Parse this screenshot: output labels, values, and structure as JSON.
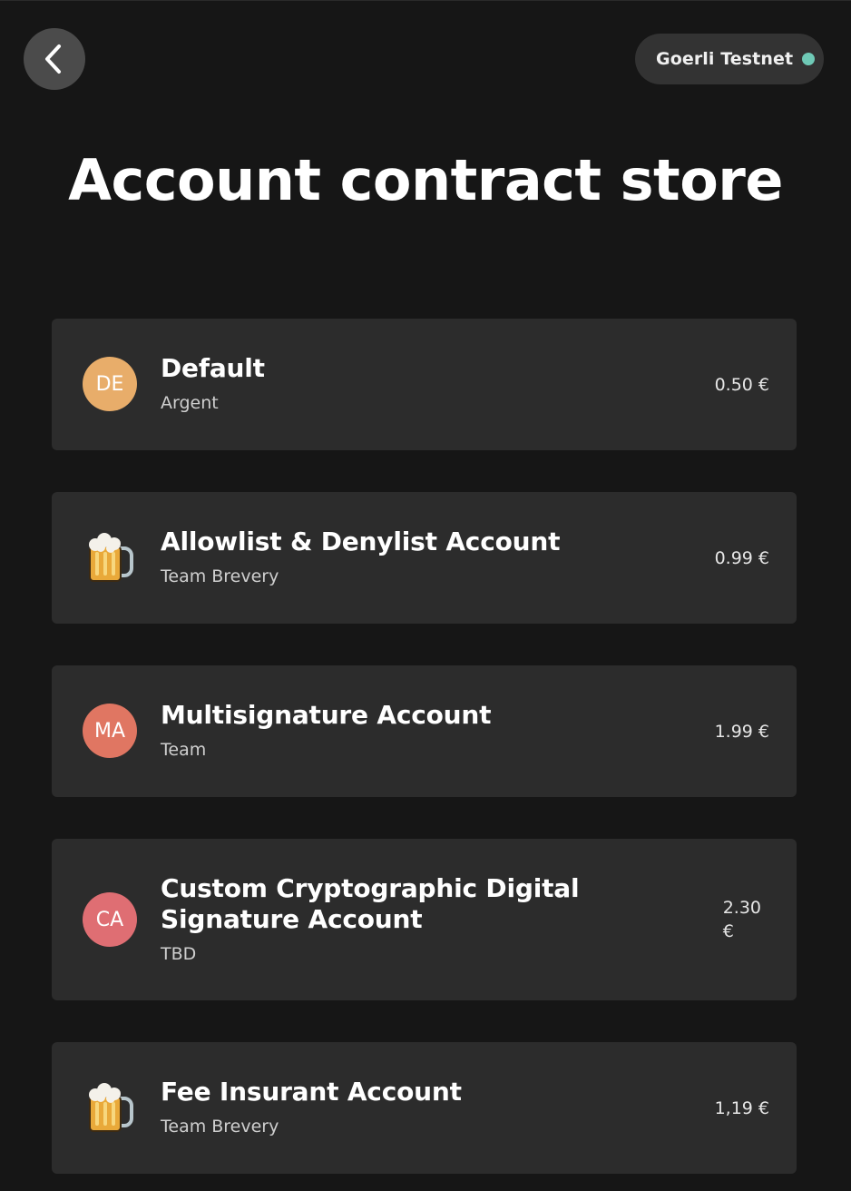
{
  "header": {
    "back_icon": "chevron-left-icon",
    "network": {
      "label": "Goerli Testnet",
      "status_color": "#6fc9b6"
    }
  },
  "page": {
    "title": "Account contract store"
  },
  "accounts": [
    {
      "initials": "DE",
      "icon": null,
      "avatar_color": "#e8ad6a",
      "name": "Default",
      "author": "Argent",
      "price": "0.50 €"
    },
    {
      "initials": "",
      "icon": "beer-mug-icon",
      "avatar_color": null,
      "name": "Allowlist & Denylist Account",
      "author": "Team Brevery",
      "price": "0.99 €"
    },
    {
      "initials": "MA",
      "icon": null,
      "avatar_color": "#e07662",
      "name": "Multisignature Account",
      "author": "Team",
      "price": "1.99 €"
    },
    {
      "initials": "CA",
      "icon": null,
      "avatar_color": "#df6e73",
      "name": "Custom Cryptographic Digital Signature Account",
      "author": "TBD",
      "price_line1": "2.30",
      "price_line2": "€"
    },
    {
      "initials": "",
      "icon": "beer-mug-icon",
      "avatar_color": null,
      "name": "Fee Insurant Account",
      "author": "Team Brevery",
      "price": "1,19 €"
    }
  ]
}
